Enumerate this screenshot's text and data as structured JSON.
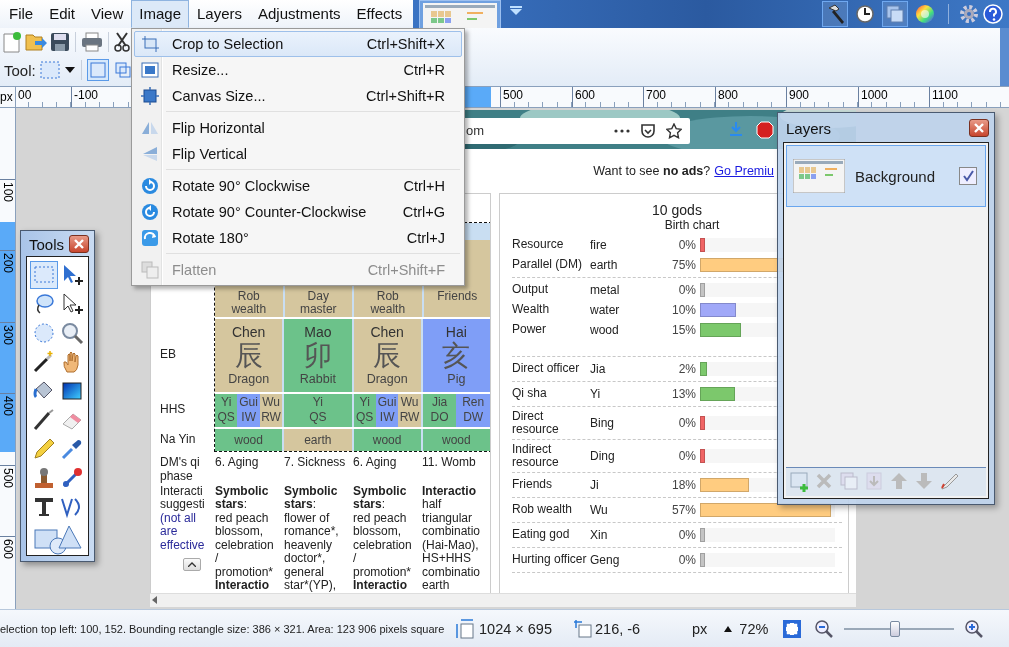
{
  "menu_bar": [
    {
      "label": "File",
      "selected": false
    },
    {
      "label": "Edit",
      "selected": false
    },
    {
      "label": "View",
      "selected": false
    },
    {
      "label": "Image",
      "selected": true
    },
    {
      "label": "Layers",
      "selected": false
    },
    {
      "label": "Adjustments",
      "selected": false
    },
    {
      "label": "Effects",
      "selected": false
    }
  ],
  "window_toggles": [
    {
      "on": true
    },
    {
      "on": false
    },
    {
      "on": true
    },
    {
      "on": false
    }
  ],
  "toolbar": {
    "tool_label": "Tool:",
    "selection_modes": [
      {
        "selected": true
      },
      {
        "selected": false
      }
    ]
  },
  "rulers": {
    "unit": "px",
    "horizontal": [
      "00",
      "-100",
      "500",
      "600",
      "700",
      "800",
      "900",
      "1000",
      "1100"
    ],
    "vertical": [
      "100",
      "200",
      "300",
      "400",
      "500",
      "600"
    ]
  },
  "image_menu": [
    {
      "kind": "item",
      "label": "Crop to Selection",
      "shortcut": "Ctrl+Shift+X",
      "selected": true,
      "disabled": false
    },
    {
      "kind": "item",
      "label": "Resize...",
      "shortcut": "Ctrl+R",
      "selected": false,
      "disabled": false
    },
    {
      "kind": "item",
      "label": "Canvas Size...",
      "shortcut": "Ctrl+Shift+R",
      "selected": false,
      "disabled": false
    },
    {
      "kind": "separator"
    },
    {
      "kind": "item",
      "label": "Flip Horizontal",
      "selected": false,
      "disabled": false
    },
    {
      "kind": "item",
      "label": "Flip Vertical",
      "selected": false,
      "disabled": false
    },
    {
      "kind": "separator"
    },
    {
      "kind": "item",
      "label": "Rotate 90° Clockwise",
      "shortcut": "Ctrl+H",
      "selected": false,
      "disabled": false
    },
    {
      "kind": "item",
      "label": "Rotate 90° Counter-Clockwise",
      "shortcut": "Ctrl+G",
      "selected": false,
      "disabled": false
    },
    {
      "kind": "item",
      "label": "Rotate 180°",
      "shortcut": "Ctrl+J",
      "selected": false,
      "disabled": false
    },
    {
      "kind": "separator"
    },
    {
      "kind": "item",
      "label": "Flatten",
      "shortcut": "Ctrl+Shift+F",
      "selected": false,
      "disabled": true
    }
  ],
  "tools_window": {
    "title": "Tools",
    "tools": [
      {
        "selected": true
      },
      {
        "selected": false
      },
      {
        "selected": false
      },
      {
        "selected": false
      },
      {
        "selected": false
      },
      {
        "selected": false
      },
      {
        "selected": false
      },
      {
        "selected": false
      },
      {
        "selected": false
      },
      {
        "selected": false
      },
      {
        "selected": false
      },
      {
        "selected": false
      },
      {
        "selected": false
      },
      {
        "selected": false
      },
      {
        "selected": false
      },
      {
        "selected": false
      },
      {
        "selected": false
      },
      {
        "selected": false
      },
      {
        "selected": false
      }
    ]
  },
  "document": {
    "address": "om",
    "promo": {
      "text": "Want to see **no ads**?",
      "link": "Go Premiu"
    },
    "pillars": {
      "god_row": [
        "Rob wealth",
        "Day master",
        "Rob wealth",
        "Friends"
      ],
      "eb_label": "EB",
      "eb": [
        {
          "pinyin": "Chen",
          "hanzi": "辰",
          "animal": "Dragon",
          "color": "#d5c69e"
        },
        {
          "pinyin": "Mao",
          "hanzi": "卯",
          "animal": "Rabbit",
          "color": "#6cc28a"
        },
        {
          "pinyin": "Chen",
          "hanzi": "辰",
          "animal": "Dragon",
          "color": "#d5c69e"
        },
        {
          "pinyin": "Hai",
          "hanzi": "亥",
          "animal": "Pig",
          "color": "#7f9ef7"
        }
      ],
      "hhs_label": "HHS",
      "hhs": [
        [
          {
            "stem": "Yi",
            "god": "QS",
            "color": "#6cc28a"
          },
          {
            "stem": "Gui",
            "god": "IW",
            "color": "#7f9ef7"
          },
          {
            "stem": "Wu",
            "god": "RW",
            "color": "#d5c69e"
          }
        ],
        [
          {
            "stem": "Yi",
            "god": "QS",
            "color": "#6cc28a"
          }
        ],
        [
          {
            "stem": "Yi",
            "god": "QS",
            "color": "#6cc28a"
          },
          {
            "stem": "Gui",
            "god": "IW",
            "color": "#7f9ef7"
          },
          {
            "stem": "Wu",
            "god": "RW",
            "color": "#d5c69e"
          }
        ],
        [
          {
            "stem": "Jia",
            "god": "DO",
            "color": "#6cc28a"
          },
          {
            "stem": "Ren",
            "god": "DW",
            "color": "#7f9ef7"
          }
        ]
      ],
      "na_yin_label": "Na Yin",
      "na_yin": [
        {
          "text": "wood",
          "color": "#6cc28a"
        },
        {
          "text": "earth",
          "color": "#d5c69e"
        },
        {
          "text": "wood",
          "color": "#6cc28a"
        },
        {
          "text": "wood",
          "color": "#6cc28a"
        }
      ]
    },
    "qi_phase": {
      "label": "DM's qi phase",
      "values": [
        "6. Aging",
        "7. Sickness",
        "6. Aging",
        "11. Womb"
      ]
    },
    "interactions": {
      "label": "Interacti\nsuggesti",
      "note": "(not all\nare\neffective",
      "values": [
        "**Symbolic**\n**stars**:\nred peach\nblossom,\ncelebration\n/\npromotion*\n**Interactio**",
        "**Symbolic**\n**stars**:\nflower of\nromance*,\nheavenly\ndoctor*,\ngeneral\nstar*(YP),",
        "**Symbolic**\n**stars**:\nred peach\nblossom,\ncelebration\n/\npromotion*\n**Interactio**",
        "**Interactio**\nhalf\ntriangular\ncombinatio\n(Hai-Mao),\nHS+HHS\ncombinatio\nearth"
      ]
    },
    "ten_gods": {
      "title": "10 gods",
      "subtitle": "Birth chart",
      "sections": [
        [
          {
            "god": "Resource",
            "element": "fire",
            "percent": "0%",
            "level": 0.04,
            "color": "#f06464"
          },
          {
            "god": "Parallel (DM)",
            "element": "earth",
            "percent": "75%",
            "level": 0.98,
            "color": "#ffcc80"
          }
        ],
        [
          {
            "god": "Output",
            "element": "metal",
            "percent": "0%",
            "level": 0.04,
            "color": "#c4c4c4"
          },
          {
            "god": "Wealth",
            "element": "water",
            "percent": "10%",
            "level": 0.27,
            "color": "#a0a8f8"
          },
          {
            "god": "Power",
            "element": "wood",
            "percent": "15%",
            "level": 0.3,
            "color": "#7cc86c"
          }
        ],
        [
          {
            "god": "Direct officer",
            "element": "Jia",
            "percent": "2%",
            "level": 0.05,
            "color": "#7cc86c"
          }
        ],
        [
          {
            "god": "Qi sha",
            "element": "Yi",
            "percent": "13%",
            "level": 0.26,
            "color": "#7cc86c"
          }
        ],
        [
          {
            "god": "Direct resource",
            "element": "Bing",
            "percent": "0%",
            "level": 0.04,
            "color": "#f06464"
          }
        ],
        [
          {
            "god": "Indirect resource",
            "element": "Ding",
            "percent": "0%",
            "level": 0.04,
            "color": "#f06464"
          }
        ],
        [
          {
            "god": "Friends",
            "element": "Ji",
            "percent": "18%",
            "level": 0.36,
            "color": "#ffcc80"
          }
        ],
        [
          {
            "god": "Rob wealth",
            "element": "Wu",
            "percent": "57%",
            "level": 0.97,
            "color": "#ffcc80"
          }
        ],
        [
          {
            "god": "Eating god",
            "element": "Xin",
            "percent": "0%",
            "level": 0.04,
            "color": "#c4c4c4"
          }
        ],
        [
          {
            "god": "Hurting officer",
            "element": "Geng",
            "percent": "0%",
            "level": 0.04,
            "color": "#c4c4c4"
          }
        ]
      ]
    }
  },
  "layers_window": {
    "title": "Layers",
    "layers": [
      {
        "name": "Background",
        "visible": true,
        "selected": true
      }
    ]
  },
  "status_bar": {
    "selection": "election top left: 100, 152. Bounding rectangle size: 386 × 321. Area: 123 906 pixels square",
    "image_size": "1024 × 695",
    "cursor": "216, -6",
    "unit": "px",
    "zoom": "72%",
    "zoom_slider": {
      "level": 0.46
    }
  }
}
